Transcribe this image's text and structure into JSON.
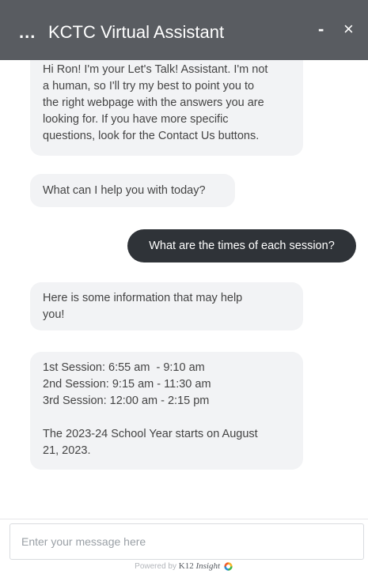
{
  "header": {
    "menu_label": "...",
    "title": "KCTC Virtual Assistant",
    "minimize_label": "-",
    "close_label": "×"
  },
  "messages": {
    "bot_intro": [
      "Hi Ron! I'm your Let's Talk! Assistant. I'm not",
      "a human, so I'll try my best to point you to",
      "the right webpage with the answers you are",
      "looking for. If you have more specific",
      "questions, look for the Contact Us buttons."
    ],
    "bot_help": "What can I help you with today?",
    "user_question": "What are the times of each session?",
    "bot_info": [
      "Here is some information that may help",
      "you!"
    ],
    "bot_sessions": [
      "1st Session: 6:55 am  - 9:10 am",
      "2nd Session: 9:15 am - 11:30 am",
      "3rd Session: 12:00 am - 2:15 pm",
      "The 2023-24 School Year starts on August",
      "21, 2023."
    ]
  },
  "composer": {
    "placeholder": "Enter your message here",
    "value": ""
  },
  "footer": {
    "powered_by": "Powered by",
    "brand": "K12",
    "brand_suffix": "Insight",
    "logo_icon": "k12-insight-logo-icon"
  },
  "colors": {
    "header_bg": "#595c61",
    "bot_bubble_bg": "#f2f3f5",
    "user_bubble_bg": "#2f3338",
    "logo_colors": [
      "#f15a29",
      "#f7b32b",
      "#3fb54a",
      "#2a8fd6"
    ]
  }
}
